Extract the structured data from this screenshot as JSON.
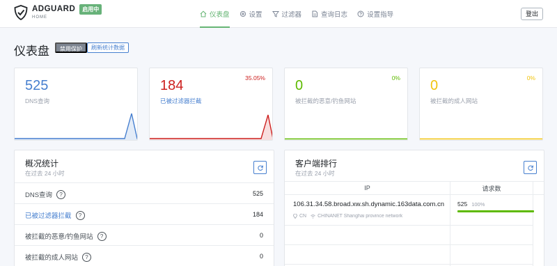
{
  "header": {
    "logo_name": "ADGUARD",
    "logo_sub": "HOME",
    "status_badge": "启用中",
    "nav": [
      {
        "label": "仪表盘",
        "icon": "home-icon",
        "active": true
      },
      {
        "label": "设置",
        "icon": "gear-icon",
        "active": false
      },
      {
        "label": "过滤器",
        "icon": "filter-icon",
        "active": false
      },
      {
        "label": "查询日志",
        "icon": "document-icon",
        "active": false
      },
      {
        "label": "设置指导",
        "icon": "help-circle-icon",
        "active": false
      }
    ],
    "logout_label": "登出"
  },
  "page": {
    "title": "仪表盘",
    "disable_protection": "禁用保护",
    "refresh_stats": "刷新统计数据"
  },
  "stat_cards": [
    {
      "value": "525",
      "label": "DNS查询",
      "percent": "",
      "color": "#467fcf"
    },
    {
      "value": "184",
      "label": "已被过滤器拦截",
      "percent": "35.05%",
      "color": "#cd201f"
    },
    {
      "value": "0",
      "label": "被拦截的恶意/钓鱼网站",
      "percent": "0%",
      "color": "#5eba00"
    },
    {
      "value": "0",
      "label": "被拦截的成人网站",
      "percent": "0%",
      "color": "#f1c40f"
    }
  ],
  "general_stats": {
    "title": "概况统计",
    "subtitle": "在过去 24 小时",
    "rows": [
      {
        "label": "DNS查询",
        "value": "525",
        "link": false
      },
      {
        "label": "已被过滤器拦截",
        "value": "184",
        "link": true
      },
      {
        "label": "被拦截的恶意/钓鱼网站",
        "value": "0",
        "link": false
      },
      {
        "label": "被拦截的成人网站",
        "value": "0",
        "link": false
      }
    ],
    "help_glyph": "?"
  },
  "top_clients": {
    "title": "客户端排行",
    "subtitle": "在过去 24 小时",
    "col_ip": "IP",
    "col_requests": "请求数",
    "rows": [
      {
        "ip": "106.31.34.58.broad.xw.sh.dynamic.163data.com.cn",
        "country": "CN",
        "network": "CHINANET Shanghai province network",
        "requests": "525",
        "percent": "100%",
        "bar_fraction": 1.0
      }
    ]
  }
}
